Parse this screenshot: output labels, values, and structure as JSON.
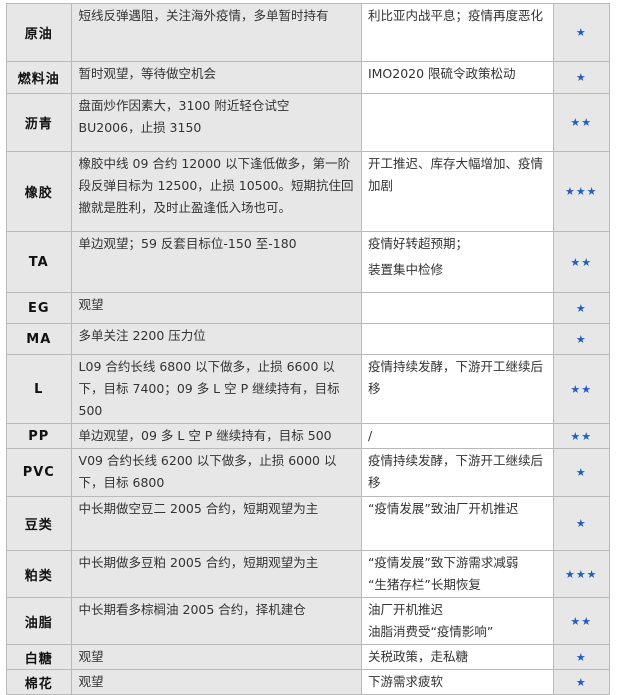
{
  "rows": [
    {
      "name": "原油",
      "view": "短线反弹遇阻，关注海外疫情，多单暂时持有",
      "logic": [
        "利比亚内战平息；疫情再度恶化"
      ],
      "stars": "★"
    },
    {
      "name": "燃料油",
      "view": "暂时观望，等待做空机会",
      "logic": [
        "IMO2020 限硫令政策松动"
      ],
      "stars": "★"
    },
    {
      "name": "沥青",
      "view": "盘面炒作因素大，3100 附近轻仓试空 BU2006，止损 3150",
      "logic": [
        ""
      ],
      "stars": "★★"
    },
    {
      "name": "橡胶",
      "view": "橡胶中线 09 合约 12000 以下逢低做多，第一阶段反弹目标为 12500，止损 10500。短期抗住回撤就是胜利，及时止盈逢低入场也可。",
      "logic": [
        "开工推迟、库存大幅增加、疫情加剧"
      ],
      "stars": "★★★"
    },
    {
      "name": "TA",
      "view": "单边观望；59 反套目标位-150 至-180",
      "logic": [
        "疫情好转超预期；",
        "装置集中检修"
      ],
      "stars": "★★"
    },
    {
      "name": "EG",
      "view": "观望",
      "logic": [
        ""
      ],
      "stars": "★"
    },
    {
      "name": "MA",
      "view": "多单关注 2200 压力位",
      "logic": [
        ""
      ],
      "stars": "★"
    },
    {
      "name": "L",
      "view": "L09 合约长线 6800 以下做多，止损 6600 以下，目标 7400；09 多 L 空 P 继续持有，目标 500",
      "logic": [
        "疫情持续发酵，下游开工继续后移"
      ],
      "stars": "★★"
    },
    {
      "name": "PP",
      "view": "单边观望，09 多 L 空 P 继续持有，目标 500",
      "logic": [
        "/"
      ],
      "stars": "★★"
    },
    {
      "name": "PVC",
      "view": "V09 合约长线 6200 以下做多，止损 6000 以下，目标 6800",
      "logic": [
        "疫情持续发酵，下游开工继续后移"
      ],
      "stars": "★"
    },
    {
      "name": "豆类",
      "view": "中长期做空豆二 2005 合约，短期观望为主",
      "logic": [
        "“疫情发展”致油厂开机推迟"
      ],
      "stars": "★"
    },
    {
      "name": "粕类",
      "view": "中长期做多豆粕 2005 合约，短期观望为主",
      "logic": [
        "“疫情发展”致下游需求减弱",
        "“生猪存栏”长期恢复"
      ],
      "stars": "★★★"
    },
    {
      "name": "油脂",
      "view": "中长期看多棕榈油 2005 合约，择机建仓",
      "logic": [
        "油厂开机推迟",
        "油脂消费受“疫情影响”"
      ],
      "stars": "★★"
    },
    {
      "name": "白糖",
      "view": "观望",
      "logic": [
        "关税政策，走私糖"
      ],
      "stars": "★"
    },
    {
      "name": "棉花",
      "view": "观望",
      "logic": [
        "下游需求疲软"
      ],
      "stars": "★"
    }
  ],
  "colors": {
    "cell_gray": "#e7e7e7",
    "border": "#b9b9b9",
    "star": "#1f5fbf"
  },
  "icons": {
    "rating": "star-icon"
  }
}
